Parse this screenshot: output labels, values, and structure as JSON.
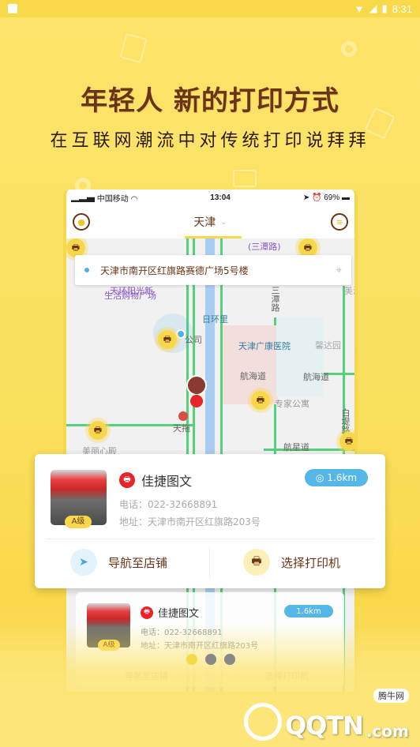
{
  "android_status": {
    "time": "8:31"
  },
  "promo": {
    "headline": "年轻人 新的打印方式",
    "subline": "在互联网潮流中对传统打印说拜拜"
  },
  "ios_status": {
    "carrier": "中国移动",
    "time": "13:04",
    "battery": "69%"
  },
  "appbar": {
    "city": "天津",
    "chevron": "⌄"
  },
  "search": {
    "address": "天津市南开区红旗路赛德广场5号楼"
  },
  "map_labels": {
    "sanhuan": "(三潭路)",
    "plaza1": "天环阳光新",
    "plaza2": "生活购物广场",
    "rihuanli": "日环里",
    "sanlu": "三潭路",
    "hospital": "天津广康医院",
    "xinda": "馨达园",
    "hanghai1": "航海道",
    "hanghai2": "航海道",
    "zhuanjia": "专家公寓",
    "tiantuo": "天拖",
    "meili": "美丽心殿",
    "hangxing": "航星道",
    "baidi": "白堤路",
    "gongsi": "公司",
    "meiji": "美滋"
  },
  "store_card": {
    "name": "佳捷图文",
    "distance": "1.6km",
    "phone": "电话：022-32668891",
    "address": "地址：天津市南开区红旗路203号",
    "grade": "A级",
    "navigate_label": "导航至店铺",
    "select_printer_label": "选择打印机"
  },
  "store_card_preview": {
    "name": "佳捷图文",
    "distance": "1.6km",
    "phone": "电话：022-32668891",
    "address": "地址：天津市南开区红旗路203号",
    "grade": "A级",
    "navigate_label": "导航至店铺",
    "select_printer_label": "选择打印机"
  },
  "pager": {
    "count": 3,
    "active": 1
  },
  "watermark": {
    "text": "QQTN",
    "suffix": ".com",
    "tag": "腾牛网"
  },
  "colors": {
    "brand_yellow": "#f8d84b",
    "brown": "#6b3416",
    "distance_blue": "#55b6e8",
    "store_red": "#e8232a"
  }
}
